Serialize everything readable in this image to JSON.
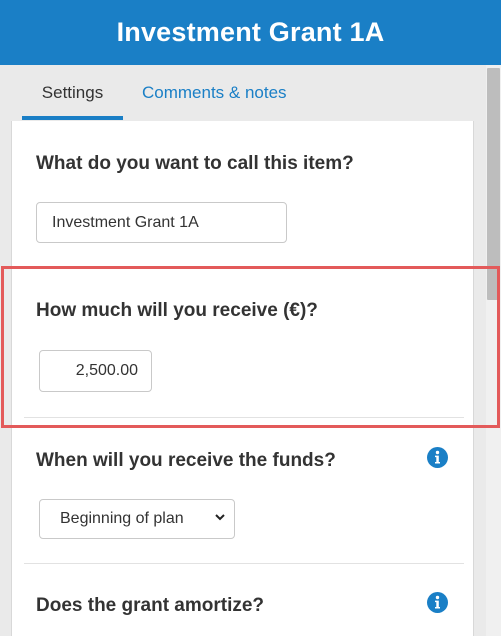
{
  "header": {
    "title": "Investment Grant 1A"
  },
  "tabs": [
    {
      "label": "Settings",
      "active": true
    },
    {
      "label": "Comments & notes",
      "active": false
    }
  ],
  "form": {
    "name_question": "What do you want to call this item?",
    "name_value": "Investment Grant 1A",
    "amount_question": "How much will you receive (€)?",
    "amount_value": "2,500.00",
    "funds_question": "When will you receive the funds?",
    "funds_selected": "Beginning of plan",
    "amortize_question": "Does the grant amortize?"
  },
  "icons": {
    "info": "info-icon",
    "dropdown": "chevron-down-icon"
  },
  "colors": {
    "brand": "#1a7fc6",
    "highlight": "#e35a5a"
  }
}
